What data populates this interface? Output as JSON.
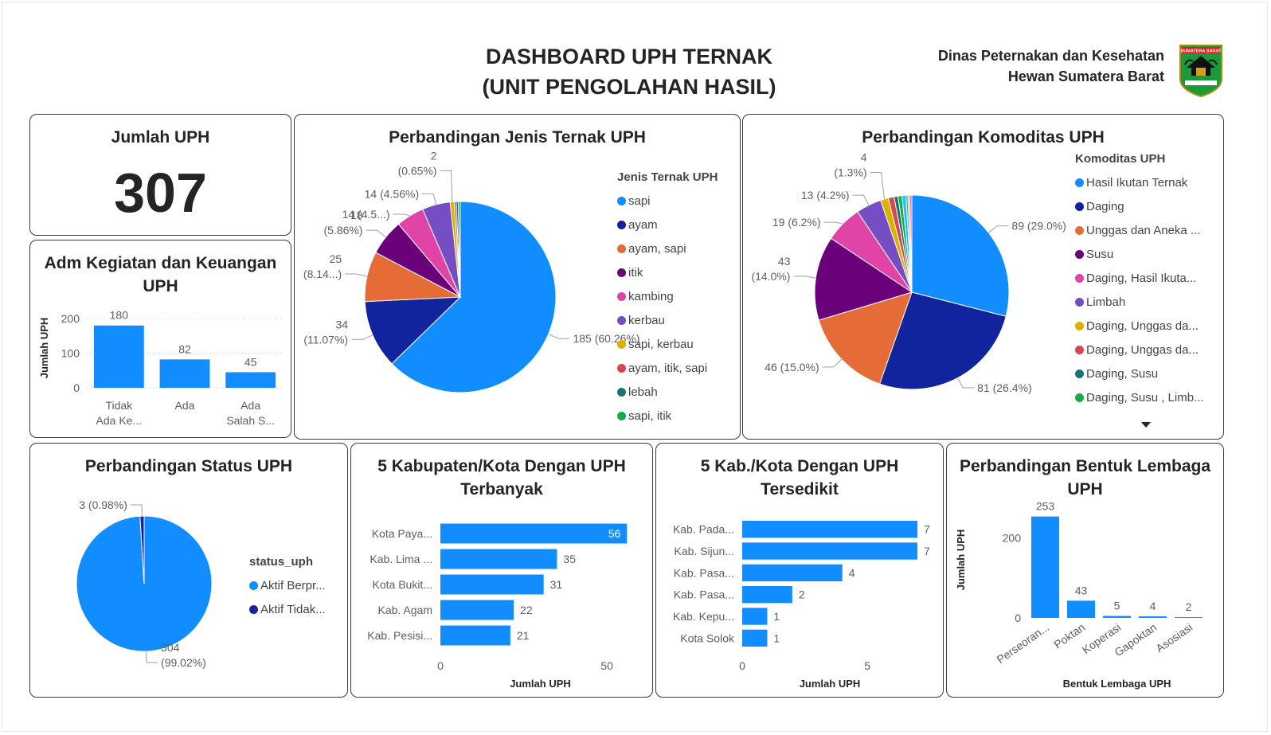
{
  "header": {
    "title_line1": "DASHBOARD UPH TERNAK",
    "title_line2": "(UNIT PENGOLAHAN HASIL)",
    "agency_line1": "Dinas Peternakan dan Kesehatan",
    "agency_line2": "Hewan Sumatera Barat",
    "logo_text": "SUMATERA BARAT"
  },
  "kpi": {
    "title": "Jumlah UPH",
    "value": "307"
  },
  "colors": {
    "bar": "#118DFF",
    "palette": [
      "#118DFF",
      "#12239E",
      "#E66C37",
      "#6B007B",
      "#E044A7",
      "#744EC2",
      "#D9B300",
      "#D64550",
      "#197278",
      "#1AAB40",
      "#15C6F4",
      "#4092FF",
      "#FFA058",
      "#BE5DC9"
    ]
  },
  "chart_data": [
    {
      "id": "adm",
      "type": "bar",
      "title_line1": "Adm Kegiatan dan Keuangan",
      "title_line2": "UPH",
      "ylabel": "Jumlah UPH",
      "xlabel": "",
      "categories": [
        [
          "Tidak",
          "Ada Ke..."
        ],
        [
          "Ada"
        ],
        [
          "Ada",
          "Salah S..."
        ]
      ],
      "values": [
        180,
        82,
        45
      ],
      "yticks": [
        "0",
        "100",
        "200"
      ],
      "ylim": [
        0,
        230
      ],
      "grid": true
    },
    {
      "id": "jenis",
      "type": "pie",
      "title": "Perbandingan Jenis Ternak UPH",
      "legend_title": "Jenis Ternak UPH",
      "legend_position": "right",
      "legend": [
        "sapi",
        "ayam",
        "ayam, sapi",
        "itik",
        "kambing",
        "kerbau",
        "sapi, kerbau",
        "ayam, itik, sapi",
        "lebah",
        "sapi, itik"
      ],
      "values": [
        185,
        34,
        25,
        18,
        14,
        14,
        2,
        1,
        1,
        1
      ],
      "labels": [
        [
          "185 (60.26%)"
        ],
        [
          "34",
          "(11.07%)"
        ],
        [
          "25",
          "(8.14...)"
        ],
        [
          "18",
          "(5.86%)"
        ],
        [
          "14 (4.5...)"
        ],
        [
          "14 (4.56%)"
        ],
        [
          "2",
          "(0.65%)"
        ]
      ]
    },
    {
      "id": "komoditas",
      "type": "pie",
      "title": "Perbandingan Komoditas UPH",
      "legend_title": "Komoditas UPH",
      "legend_position": "right",
      "legend": [
        "Hasil Ikutan Ternak",
        "Daging",
        "Unggas dan Aneka ...",
        "Susu",
        "Daging, Hasil Ikuta...",
        "Limbah",
        "Daging, Unggas da...",
        "Daging, Unggas da...",
        "Daging, Susu",
        "Daging, Susu , Limb..."
      ],
      "values": [
        89,
        81,
        46,
        43,
        19,
        13,
        4,
        3,
        2,
        2,
        2,
        1,
        1,
        1
      ],
      "labels": [
        [
          "89 (29.0%)"
        ],
        [
          "81 (26.4%)"
        ],
        [
          "46 (15.0%)"
        ],
        [
          "43",
          "(14.0%)"
        ],
        [
          "19 (6.2%)"
        ],
        [
          "13 (4.2%)"
        ],
        [
          "4",
          "(1.3%)"
        ]
      ]
    },
    {
      "id": "status",
      "type": "pie",
      "title": "Perbandingan Status UPH",
      "legend_title": "status_uph",
      "legend_position": "right",
      "legend": [
        "Aktif Berpr...",
        "Aktif Tidak..."
      ],
      "values": [
        304,
        3
      ],
      "labels": [
        [
          "304",
          "(99.02%)"
        ],
        [
          "3 (0.98%)"
        ]
      ]
    },
    {
      "id": "top5",
      "type": "bar",
      "orientation": "horizontal",
      "title_line1": "5 Kabupaten/Kota Dengan UPH",
      "title_line2": "Terbanyak",
      "xlabel": "Jumlah UPH",
      "categories": [
        "Kota Paya...",
        "Kab. Lima ...",
        "Kota Bukit...",
        "Kab. Agam",
        "Kab. Pesisi..."
      ],
      "values": [
        56,
        35,
        31,
        22,
        21
      ],
      "xticks": [
        "0",
        "50"
      ],
      "xlim": [
        0,
        60
      ]
    },
    {
      "id": "bottom5",
      "type": "bar",
      "orientation": "horizontal",
      "title_line1": "5 Kab./Kota Dengan UPH",
      "title_line2": "Tersedikit",
      "xlabel": "Jumlah UPH",
      "categories": [
        "Kab. Pada...",
        "Kab. Sijun...",
        "Kab. Pasa...",
        "Kab. Pasa...",
        "Kab. Kepu...",
        "Kota Solok"
      ],
      "values": [
        7,
        7,
        4,
        2,
        1,
        1
      ],
      "xticks": [
        "0",
        "5"
      ],
      "xlim": [
        0,
        7
      ]
    },
    {
      "id": "lembaga",
      "type": "bar",
      "title_line1": "Perbandingan Bentuk Lembaga",
      "title_line2": "UPH",
      "ylabel": "Jumlah UPH",
      "xlabel": "Bentuk Lembaga UPH",
      "categories": [
        "Perseoran...",
        "Poktan",
        "Koperasi",
        "Gapoktan",
        "Asosiasi"
      ],
      "values": [
        253,
        43,
        5,
        4,
        2
      ],
      "yticks": [
        "0",
        "200"
      ],
      "ylim": [
        0,
        290
      ]
    }
  ]
}
